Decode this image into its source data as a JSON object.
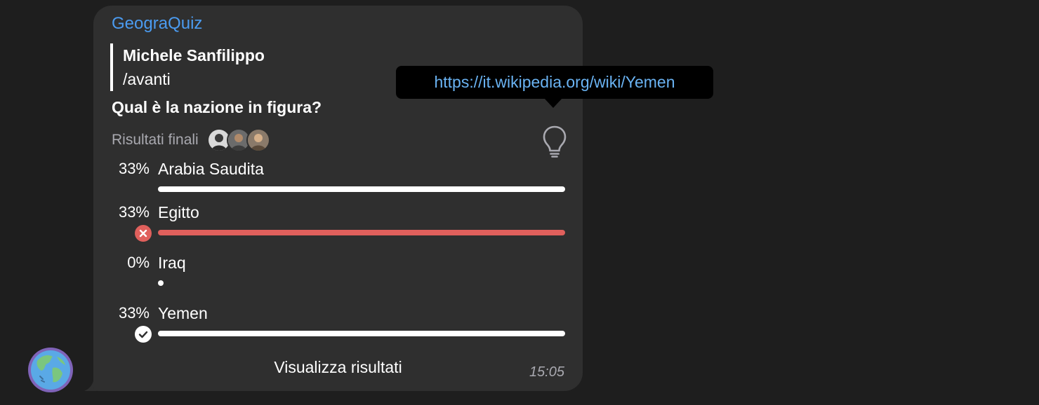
{
  "message": {
    "sender": "GeograQuiz",
    "reply": {
      "author": "Michele Sanfilippo",
      "text": "/avanti"
    },
    "time": "15:05"
  },
  "poll": {
    "question": "Qual è la nazione in figura?",
    "status": "Risultati finali",
    "view_results_label": "Visualizza risultati",
    "options": [
      {
        "label": "Arabia Saudita",
        "percent_label": "33%",
        "fill": 1.0,
        "mark": "none"
      },
      {
        "label": "Egitto",
        "percent_label": "33%",
        "fill": 1.0,
        "mark": "wrong"
      },
      {
        "label": "Iraq",
        "percent_label": "0%",
        "fill": 0,
        "mark": "none"
      },
      {
        "label": "Yemen",
        "percent_label": "33%",
        "fill": 1.0,
        "mark": "correct"
      }
    ]
  },
  "tooltip": {
    "text": "https://it.wikipedia.org/wiki/Yemen"
  },
  "colors": {
    "background": "#1e1e1e",
    "bubble": "#2f2f2f",
    "sender": "#4b9bf0",
    "link": "#6ab3f3",
    "wrong": "#e0605c",
    "muted": "#a9a9b0"
  },
  "icons": {
    "hint": "lightbulb-icon",
    "wrong": "cross-circle-icon",
    "correct": "check-circle-icon",
    "bot_avatar": "globe-icon"
  }
}
